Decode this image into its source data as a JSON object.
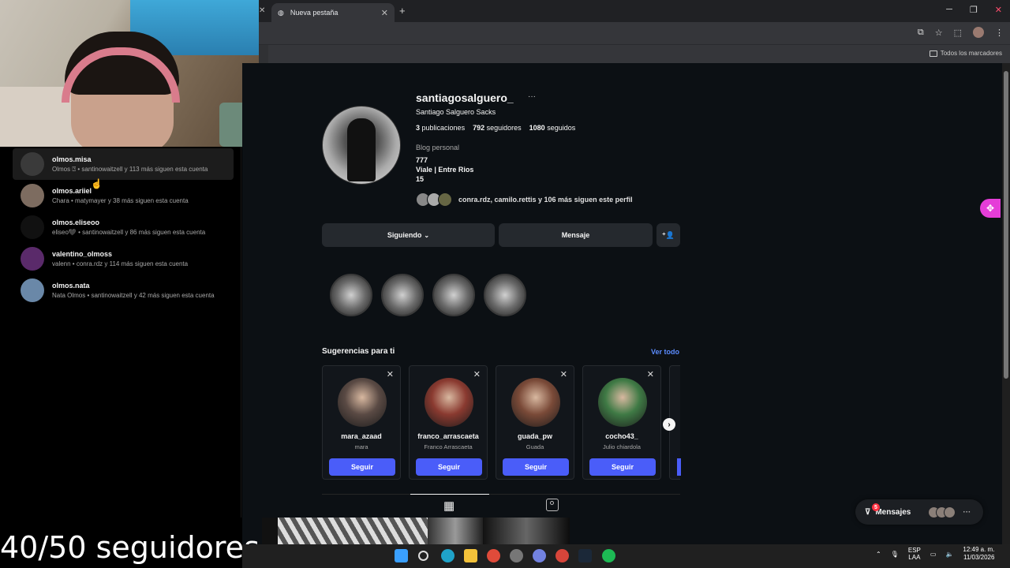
{
  "browser": {
    "tab_title": "Nueva pestaña",
    "bookmarks_label": "Todos los marcadores"
  },
  "left_panel": {
    "items": [
      {
        "name": "olmos.misa",
        "subtitle": "Olmos ⍰ • santinowaitzell y 113 más siguen esta cuenta",
        "avatar_color": "#3a3a3a"
      },
      {
        "name": "olmos.ariiel",
        "subtitle": "Chara • matymayer y 38 más siguen esta cuenta",
        "avatar_color": "#7d6c60"
      },
      {
        "name": "olmos.eliseoo",
        "subtitle": "eliseo🖤 • santinowaitzell y 86 más siguen esta cuenta",
        "avatar_color": "#111111"
      },
      {
        "name": "valentino_olmoss",
        "subtitle": "valenn • conra.rdz y 114 más siguen esta cuenta",
        "avatar_color": "#5a2a6a"
      },
      {
        "name": "olmos.nata",
        "subtitle": "Nata Olmos • santinowaitzell y 42 más siguen esta cuenta",
        "avatar_color": "#6a88a8"
      }
    ]
  },
  "profile": {
    "username": "santiagosalguero_",
    "full_name": "Santiago Salguero Sacks",
    "posts_count": "3",
    "posts_label": "publicaciones",
    "followers_count": "792",
    "followers_label": "seguidores",
    "following_count": "1080",
    "following_label": "seguidos",
    "category": "Blog personal",
    "bio_line1": "777",
    "bio_line2": "Viale | Entre Rios",
    "bio_line3": "15",
    "mutuals_text": "conra.rdz, camilo.rettis y 106 más siguen este perfil",
    "following_button": "Siguiendo",
    "message_button": "Mensaje"
  },
  "suggestions": {
    "title": "Sugerencias para ti",
    "see_all": "Ver todo",
    "cards": [
      {
        "username": "mara_azaad",
        "name": "mara",
        "button": "Seguir",
        "avatar_color": "#5a4a44"
      },
      {
        "username": "franco_arrascaeta",
        "name": "Franco Arrascaeta",
        "button": "Seguir",
        "avatar_color": "#8a3a30"
      },
      {
        "username": "guada_pw",
        "name": "Guada",
        "button": "Seguir",
        "avatar_color": "#7a4a38"
      },
      {
        "username": "cocho43_",
        "name": "Julio chiardola",
        "button": "Seguir",
        "avatar_color": "#3f7a45"
      }
    ]
  },
  "messages": {
    "label": "Mensajes",
    "badge": "5"
  },
  "overlay_text": "40/50 seguidores",
  "tray": {
    "lang1": "ESP",
    "lang2": "LAA",
    "time": "12:49 a. m.",
    "date": "11/03/2026"
  },
  "colors": {
    "accent_blue": "#4a5df9",
    "link_blue": "#5b8cff",
    "badge_red": "#ff3040",
    "extension_pink": "#e53dd8"
  }
}
